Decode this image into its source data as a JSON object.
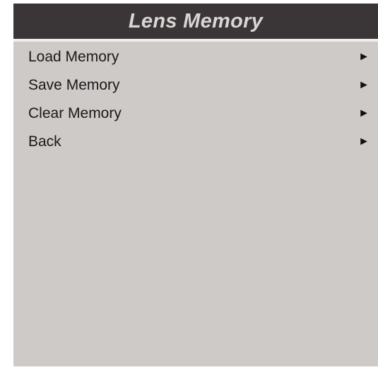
{
  "menu": {
    "title": "Lens Memory",
    "items": [
      {
        "label": "Load Memory",
        "arrow": "►",
        "icon": "play-right-icon"
      },
      {
        "label": "Save Memory",
        "arrow": "►",
        "icon": "play-right-icon"
      },
      {
        "label": "Clear Memory",
        "arrow": "►",
        "icon": "play-right-icon"
      },
      {
        "label": "Back",
        "arrow": "►",
        "icon": "play-right-icon"
      }
    ]
  },
  "colors": {
    "title_bar_bg": "#3a3536",
    "title_text": "#d8d6d5",
    "panel_bg": "#cdcac8",
    "item_text": "#1a1a1a"
  }
}
